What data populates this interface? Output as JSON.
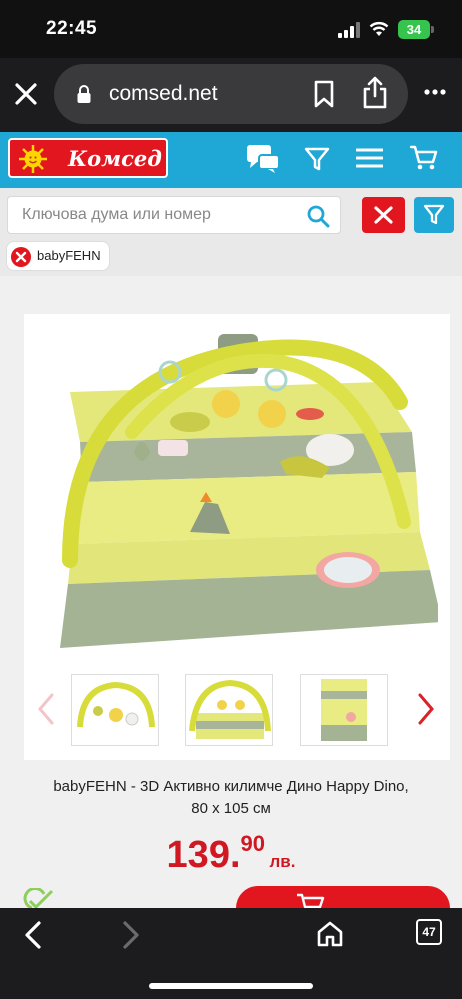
{
  "status_bar": {
    "time": "22:45",
    "battery": "34"
  },
  "browser": {
    "url": "comsed.net",
    "tab_count": "47"
  },
  "site": {
    "logo_text": "Комсед",
    "search_placeholder": "Ключова дума или номер",
    "active_filter": "babyFEHN"
  },
  "product": {
    "title_line1": "babyFEHN - 3D Активно килимче Дино Happy Dino,",
    "title_line2": "80 х 105 см",
    "price_main": "139.",
    "price_cents": "90",
    "currency": "лв."
  },
  "icons": {
    "close": "close-icon",
    "lock": "lock-icon",
    "bookmark": "bookmark-icon",
    "share": "share-icon",
    "more": "more-icon",
    "chat": "chat-icon",
    "filter": "filter-icon",
    "menu": "menu-icon",
    "cart": "cart-icon",
    "search": "search-icon",
    "back": "back-icon",
    "forward": "forward-icon",
    "home": "home-icon",
    "tabs": "tabs-icon"
  },
  "colors": {
    "brand_blue": "#1fa7d6",
    "brand_red": "#e1161f",
    "price_red": "#d01822"
  }
}
